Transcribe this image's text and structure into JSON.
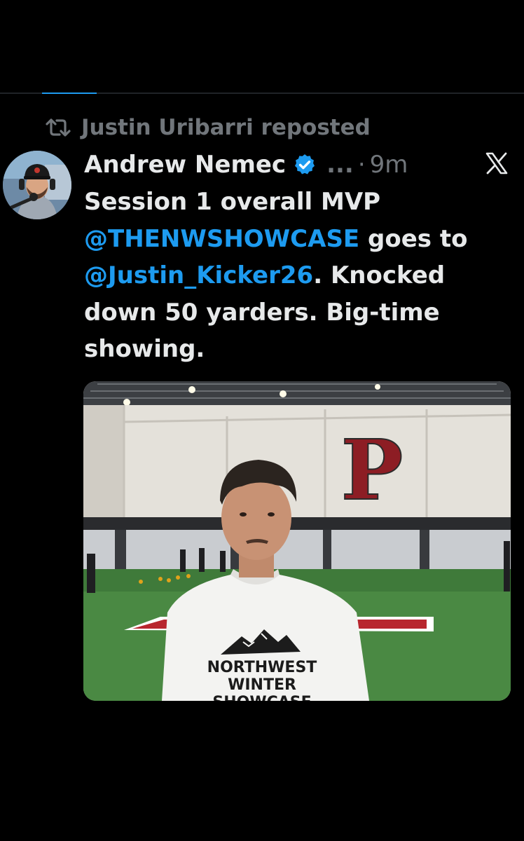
{
  "repost": {
    "icon": "repost-icon",
    "text": "Justin Uribarri reposted"
  },
  "post": {
    "author_name": "Andrew Nemec",
    "verified": true,
    "more": "...",
    "separator": "·",
    "time": "9m",
    "platform_icon": "x-logo-icon",
    "text": {
      "line1": "Session 1 overall MVP",
      "mention1": "@THENWSHOWCASE",
      "after_mention1": " goes to",
      "mention2": "@Justin_Kicker26",
      "after_mention2": ". Knocked down 50 yarders. Big-time showing."
    }
  },
  "photo": {
    "wall_letter": "P",
    "shirt_line1": "NORTHWEST",
    "shirt_line2": "WINTER",
    "shirt_line3": "SHOWCASE"
  },
  "colors": {
    "accent": "#1d9bf0",
    "muted": "#71767b",
    "text": "#e7e9ea",
    "background": "#000000"
  }
}
